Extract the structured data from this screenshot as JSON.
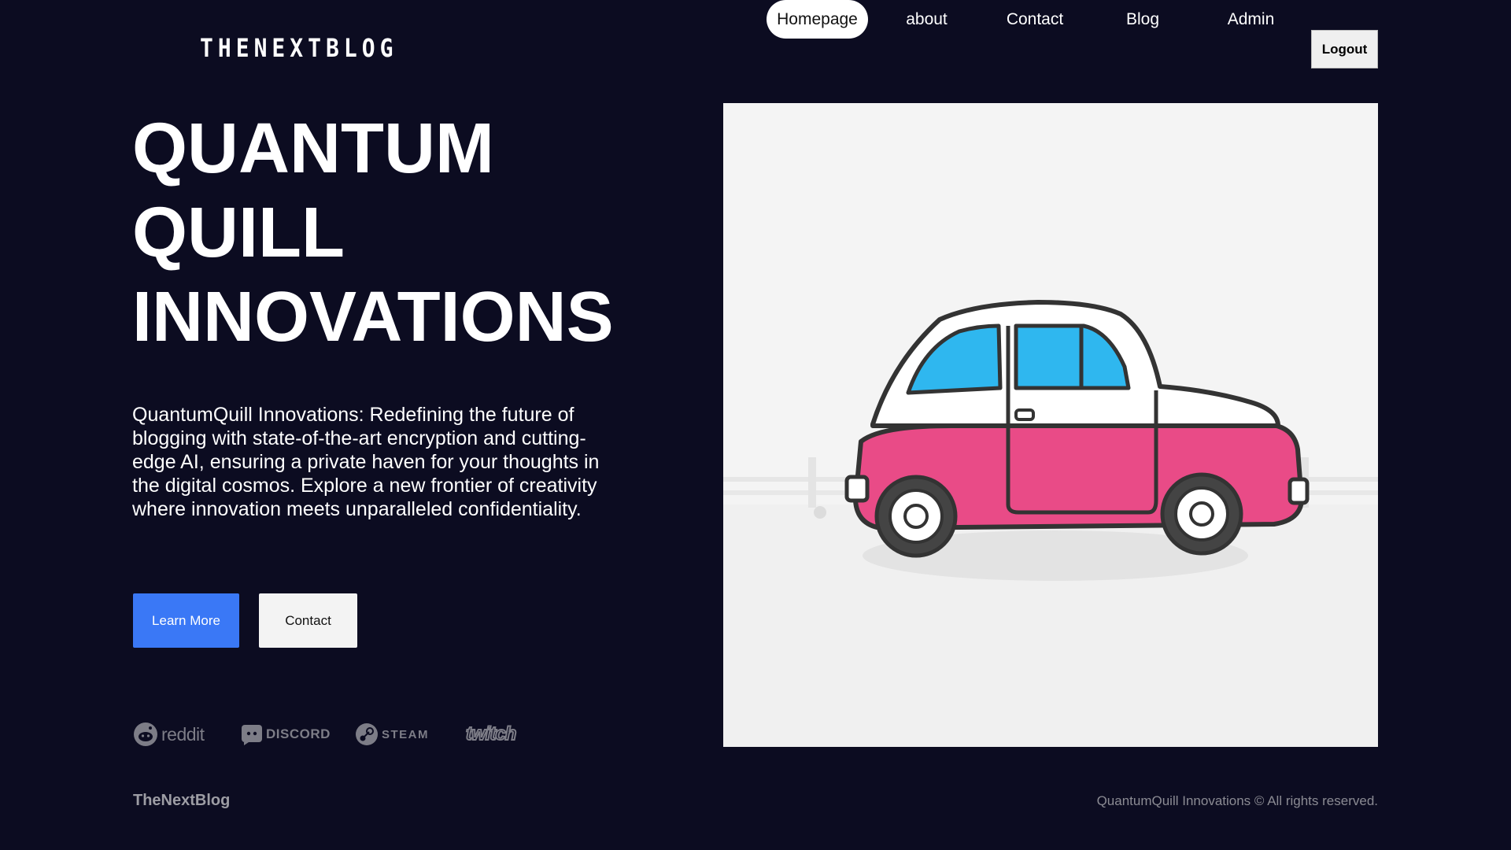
{
  "header": {
    "logo": "THENEXTBLOG",
    "nav": [
      {
        "label": "Homepage",
        "active": true
      },
      {
        "label": "about",
        "active": false
      },
      {
        "label": "Contact",
        "active": false
      },
      {
        "label": "Blog",
        "active": false
      },
      {
        "label": "Admin",
        "active": false
      }
    ],
    "logout_label": "Logout"
  },
  "hero": {
    "title_lines": [
      "QUANTUM",
      "QUILL",
      "INNOVATIONS"
    ],
    "description": "QuantumQuill Innovations: Redefining the future of blogging with state-of-the-art encryption and cutting-edge AI, ensuring a private haven for your thoughts in the digital cosmos. Explore a new frontier of creativity where innovation meets unparalleled confidentiality.",
    "primary_button": "Learn More",
    "secondary_button": "Contact"
  },
  "brands": [
    {
      "name": "reddit",
      "icon": "reddit-icon"
    },
    {
      "name": "DISCORD",
      "icon": "discord-icon"
    },
    {
      "name": "STEAM",
      "icon": "steam-icon"
    },
    {
      "name": "twitch",
      "icon": "twitch-icon"
    }
  ],
  "illustration": {
    "icon": "car-illustration",
    "body_color": "#e94b87",
    "window_color": "#2fb7ef"
  },
  "footer": {
    "brand": "TheNextBlog",
    "copyright": "QuantumQuill Innovations © All rights reserved."
  },
  "colors": {
    "background": "#0c0c21",
    "accent": "#3a78f6"
  }
}
